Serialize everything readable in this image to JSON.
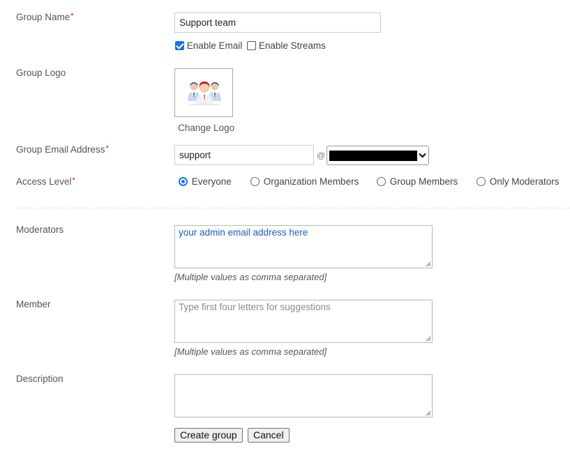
{
  "form": {
    "group_name": {
      "label": "Group Name",
      "required_mark": "*",
      "value": "Support team"
    },
    "options": {
      "enable_email": {
        "label": "Enable Email",
        "checked": true
      },
      "enable_streams": {
        "label": "Enable Streams",
        "checked": false
      }
    },
    "group_logo": {
      "label": "Group Logo",
      "change_link": "Change Logo",
      "logo_icon": "group-people-icon"
    },
    "group_email": {
      "label": "Group Email Address",
      "required_mark": "*",
      "value": "support",
      "at_sign": "@",
      "domain_value": ""
    },
    "access_level": {
      "label": "Access Level",
      "required_mark": "*",
      "options": [
        {
          "label": "Everyone",
          "selected": true
        },
        {
          "label": "Organization Members",
          "selected": false
        },
        {
          "label": "Group Members",
          "selected": false
        },
        {
          "label": "Only Moderators",
          "selected": false
        }
      ]
    },
    "moderators": {
      "label": "Moderators",
      "value": "your admin email address here",
      "hint": "[Multiple values as comma separated]"
    },
    "member": {
      "label": "Member",
      "placeholder": "Type first four letters for suggestions",
      "hint": "[Multiple values as comma separated]"
    },
    "description": {
      "label": "Description",
      "value": ""
    }
  },
  "actions": {
    "create_label": "Create group",
    "cancel_label": "Cancel"
  },
  "colors": {
    "accent": "#1a73e8",
    "required": "#d0021b",
    "link_text": "#1a5fb4"
  }
}
